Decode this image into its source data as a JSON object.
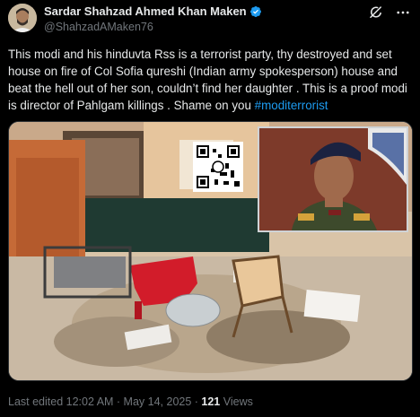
{
  "author": {
    "display_name": "Sardar Shahzad Ahmed Khan Maken",
    "handle": "@ShahzadAMaken76",
    "verified": true
  },
  "tweet": {
    "text": "This modi and his hinduvta Rss is a terrorist party, thy destroyed and set house on fire of Col Sofia qureshi (Indian army spokesperson) house and beat the hell out of her son, couldn’t find her daughter . This is a proof modi is director of Pahlgam killings . Shame on you ",
    "hashtag": "#moditerrorist"
  },
  "meta": {
    "edited_label": "Last edited 12:02 AM · May 14, 2025 · ",
    "views_count": "121",
    "views_label": " Views"
  },
  "icons": {
    "verified": "verified-badge-icon",
    "grok": "grok-icon",
    "more": "more-options-icon"
  },
  "colors": {
    "background": "#000000",
    "text": "#e7e9ea",
    "secondary": "#71767b",
    "link": "#1d9bf0"
  }
}
